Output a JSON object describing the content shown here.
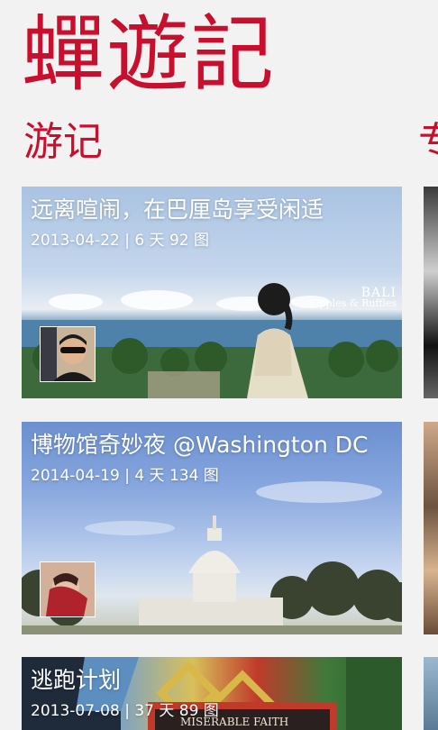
{
  "app": {
    "title": "蟬遊記"
  },
  "sections": [
    {
      "label": "游记"
    },
    {
      "label": "专"
    }
  ],
  "trips": [
    {
      "title": "远离喧闹，在巴厘岛享受闲适",
      "meta": "2013-04-22 | 6 天 92 图",
      "watermark_line1": "BALI",
      "watermark_line2": "Ripples & Ruffles"
    },
    {
      "title": "博物馆奇妙夜 @Washington DC",
      "meta": "2014-04-19 | 4 天 134 图"
    },
    {
      "title": "逃跑计划",
      "meta": "2013-07-08 | 37 天 89 图",
      "sign_text": "MISERABLE FAITH"
    }
  ],
  "colors": {
    "accent": "#c8102e",
    "background": "#f2f2f2"
  }
}
